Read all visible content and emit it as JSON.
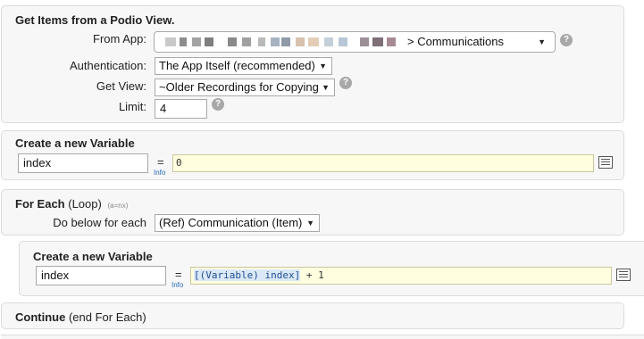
{
  "get_items": {
    "title": "Get Items from a Podio View.",
    "from_app_label": "From App:",
    "from_app_value": "> Communications",
    "authentication_label": "Authentication:",
    "authentication_value": "The App Itself (recommended)",
    "get_view_label": "Get View:",
    "get_view_value": "~Older Recordings for Copying",
    "limit_label": "Limit:",
    "limit_value": "4",
    "help_glyph": "?"
  },
  "var1": {
    "title": "Create a new Variable",
    "name": "index",
    "equals": "=",
    "info": "Info",
    "expression": "0"
  },
  "foreach": {
    "title": "For Each",
    "title_suffix": "(Loop)",
    "hint": "(a=nx)",
    "do_below_label": "Do below for each",
    "item_value": "(Ref) Communication (Item)"
  },
  "var2": {
    "title": "Create a new Variable",
    "name": "index",
    "equals": "=",
    "info": "Info",
    "expression_token": "[(Variable) index]",
    "expression_rest": " + 1"
  },
  "continue": {
    "title": "Continue",
    "suffix": "(end For Each)"
  },
  "icons": {
    "dropdown": "chevron-down-icon",
    "help": "help-icon",
    "edit": "expression-editor-icon"
  },
  "colors": {
    "panel_bg": "#f7f7f7",
    "expression_bg": "#ffffe0",
    "help_bg": "#a8a8a8",
    "info_link": "#2a6cb8"
  }
}
